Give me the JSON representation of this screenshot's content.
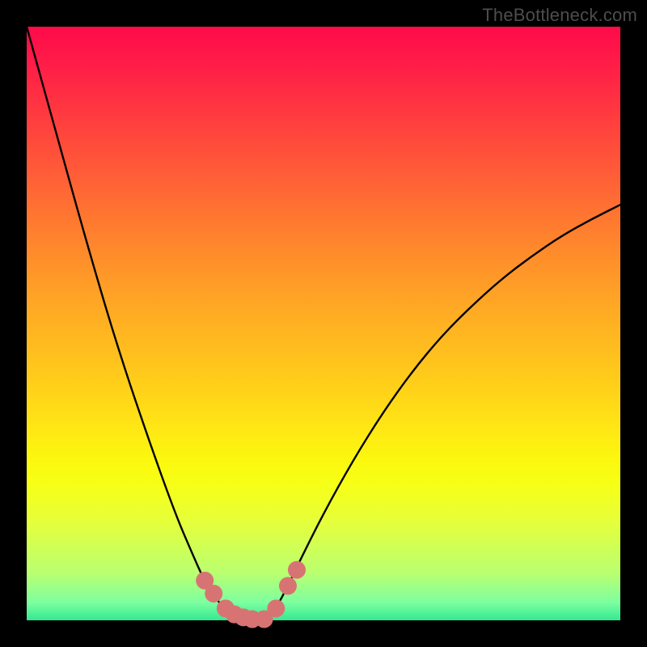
{
  "watermark": "TheBottleneck.com",
  "chart_data": {
    "type": "line",
    "title": "",
    "xlabel": "",
    "ylabel": "",
    "xlim": [
      0,
      1
    ],
    "ylim": [
      0,
      1
    ],
    "series": [
      {
        "name": "curve",
        "x": [
          0.0,
          0.05,
          0.1,
          0.15,
          0.2,
          0.25,
          0.28,
          0.3,
          0.32,
          0.34,
          0.36,
          0.38,
          0.4,
          0.42,
          0.44,
          0.46,
          0.5,
          0.55,
          0.6,
          0.65,
          0.7,
          0.75,
          0.8,
          0.85,
          0.9,
          0.95,
          1.0
        ],
        "y": [
          1.0,
          0.82,
          0.64,
          0.47,
          0.32,
          0.18,
          0.11,
          0.065,
          0.035,
          0.012,
          0.003,
          0.0,
          0.002,
          0.02,
          0.058,
          0.1,
          0.18,
          0.27,
          0.35,
          0.42,
          0.48,
          0.53,
          0.575,
          0.613,
          0.647,
          0.675,
          0.7
        ]
      }
    ],
    "markers": {
      "x": [
        0.3,
        0.315,
        0.335,
        0.35,
        0.365,
        0.38,
        0.4,
        0.42,
        0.44,
        0.455
      ],
      "y": [
        0.067,
        0.045,
        0.02,
        0.01,
        0.005,
        0.002,
        0.002,
        0.02,
        0.058,
        0.085
      ],
      "style": "circle",
      "color": "#d87373",
      "radius_px": 11
    }
  },
  "colors": {
    "frame": "#000000",
    "curve": "#000000",
    "marker": "#d87373",
    "watermark": "#4d4d4d"
  }
}
